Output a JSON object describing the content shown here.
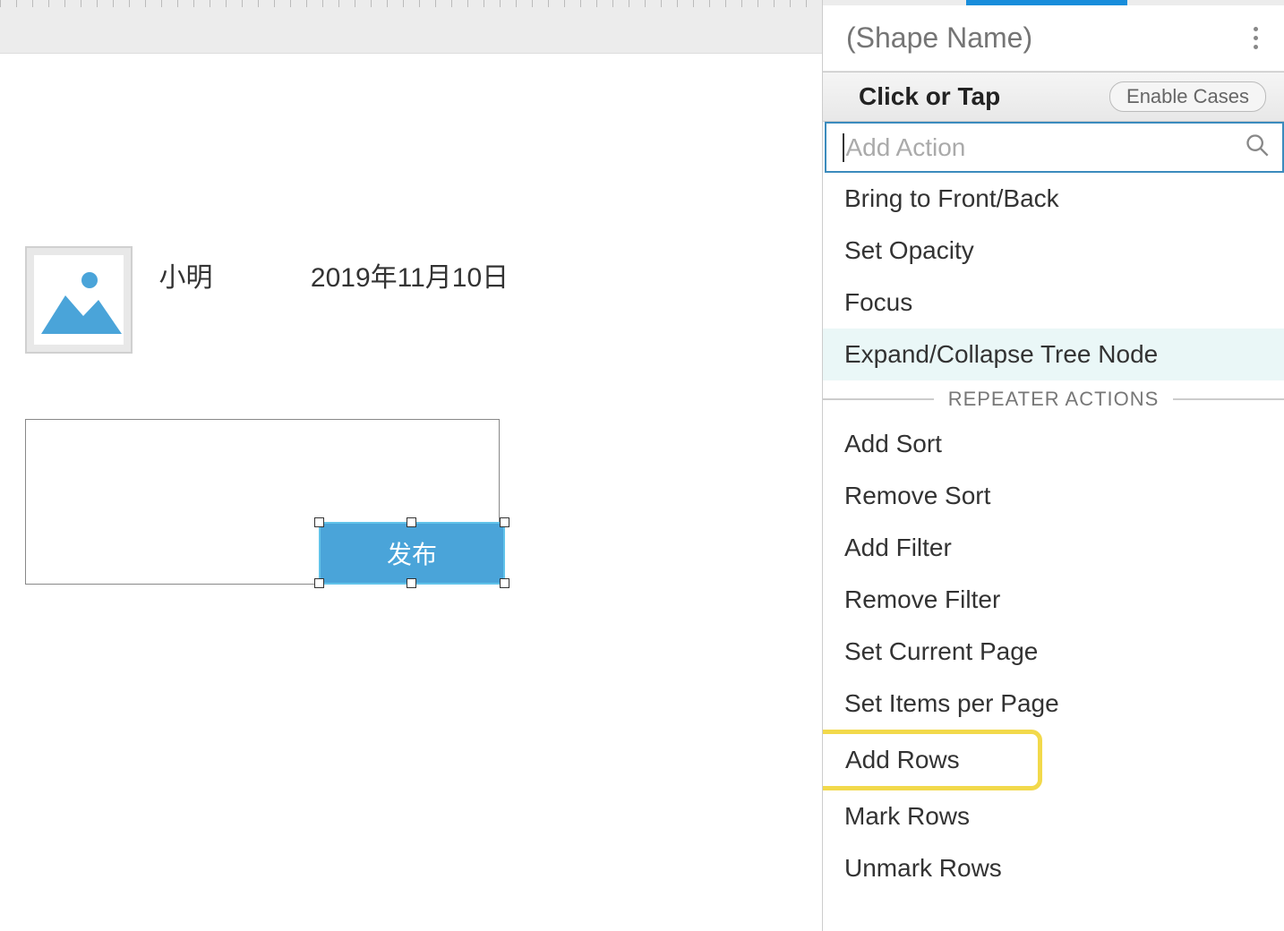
{
  "canvas": {
    "username": "小明",
    "date": "2019年11月10日",
    "publish_button_label": "发布"
  },
  "panel": {
    "shape_name_placeholder": "(Shape Name)",
    "event_title": "Click or Tap",
    "enable_cases_label": "Enable Cases",
    "search_placeholder": "Add Action",
    "section_label": "REPEATER ACTIONS",
    "actions_top": [
      {
        "label": "Bring to Front/Back",
        "highlighted": false
      },
      {
        "label": "Set Opacity",
        "highlighted": false
      },
      {
        "label": "Focus",
        "highlighted": false
      },
      {
        "label": "Expand/Collapse Tree Node",
        "highlighted": true
      }
    ],
    "actions_repeater": [
      {
        "label": "Add Sort"
      },
      {
        "label": "Remove Sort"
      },
      {
        "label": "Add Filter"
      },
      {
        "label": "Remove Filter"
      },
      {
        "label": "Set Current Page"
      },
      {
        "label": "Set Items per Page"
      },
      {
        "label": "Add Rows",
        "yellow": true
      },
      {
        "label": "Mark Rows"
      },
      {
        "label": "Unmark Rows"
      }
    ]
  }
}
